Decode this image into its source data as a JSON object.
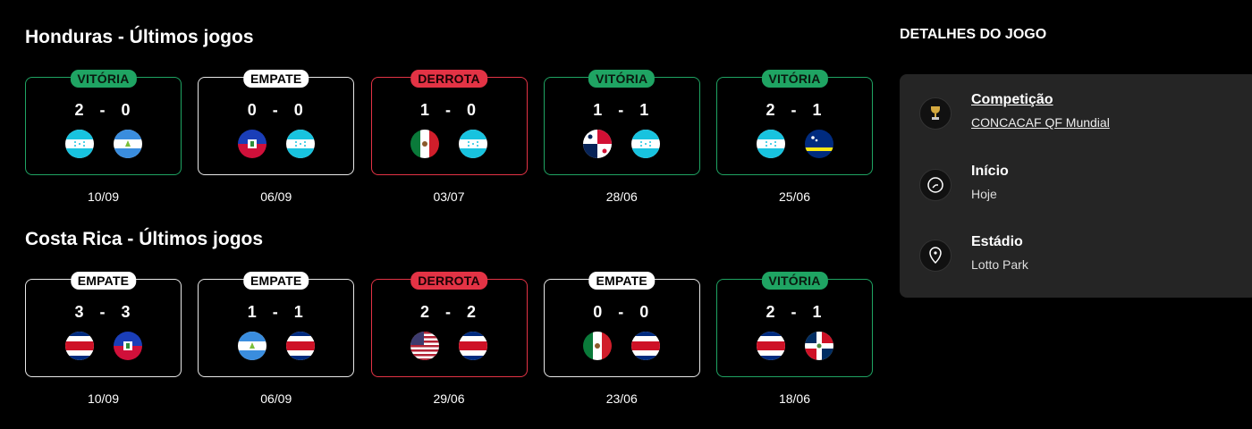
{
  "honduras": {
    "title": "Honduras - Últimos jogos",
    "matches": [
      {
        "result": "VITÓRIA",
        "home": "2",
        "away": "0",
        "date": "10/09",
        "home_flag": "honduras-flag",
        "away_flag": "nicaragua-flag"
      },
      {
        "result": "EMPATE",
        "home": "0",
        "away": "0",
        "date": "06/09",
        "home_flag": "haiti-flag",
        "away_flag": "honduras-flag"
      },
      {
        "result": "DERROTA",
        "home": "1",
        "away": "0",
        "date": "03/07",
        "home_flag": "mexico-flag",
        "away_flag": "honduras-flag"
      },
      {
        "result": "VITÓRIA",
        "home": "1",
        "away": "1",
        "date": "28/06",
        "home_flag": "panama-flag",
        "away_flag": "honduras-flag"
      },
      {
        "result": "VITÓRIA",
        "home": "2",
        "away": "1",
        "date": "25/06",
        "home_flag": "honduras-flag",
        "away_flag": "curacao-flag"
      }
    ]
  },
  "costa_rica": {
    "title": "Costa Rica - Últimos jogos",
    "matches": [
      {
        "result": "EMPATE",
        "home": "3",
        "away": "3",
        "date": "10/09",
        "home_flag": "costa-rica-flag",
        "away_flag": "haiti-flag"
      },
      {
        "result": "EMPATE",
        "home": "1",
        "away": "1",
        "date": "06/09",
        "home_flag": "nicaragua-flag",
        "away_flag": "costa-rica-flag"
      },
      {
        "result": "DERROTA",
        "home": "2",
        "away": "2",
        "date": "29/06",
        "home_flag": "usa-flag",
        "away_flag": "costa-rica-flag"
      },
      {
        "result": "EMPATE",
        "home": "0",
        "away": "0",
        "date": "23/06",
        "home_flag": "mexico-flag",
        "away_flag": "costa-rica-flag"
      },
      {
        "result": "VITÓRIA",
        "home": "2",
        "away": "1",
        "date": "18/06",
        "home_flag": "costa-rica-flag",
        "away_flag": "dominican-republic-flag"
      }
    ]
  },
  "score_separator": "-",
  "details": {
    "title": "DETALHES DO JOGO",
    "competition": {
      "label": "Competição",
      "value": "CONCACAF QF Mundial",
      "icon": "trophy-icon"
    },
    "start": {
      "label": "Início",
      "value": "Hoje",
      "icon": "clock-icon"
    },
    "stadium": {
      "label": "Estádio",
      "value": "Lotto Park",
      "icon": "location-pin-icon"
    }
  },
  "colors": {
    "win": "#1fa463",
    "loss": "#e33345",
    "draw": "#ffffff",
    "panel": "#252525"
  }
}
